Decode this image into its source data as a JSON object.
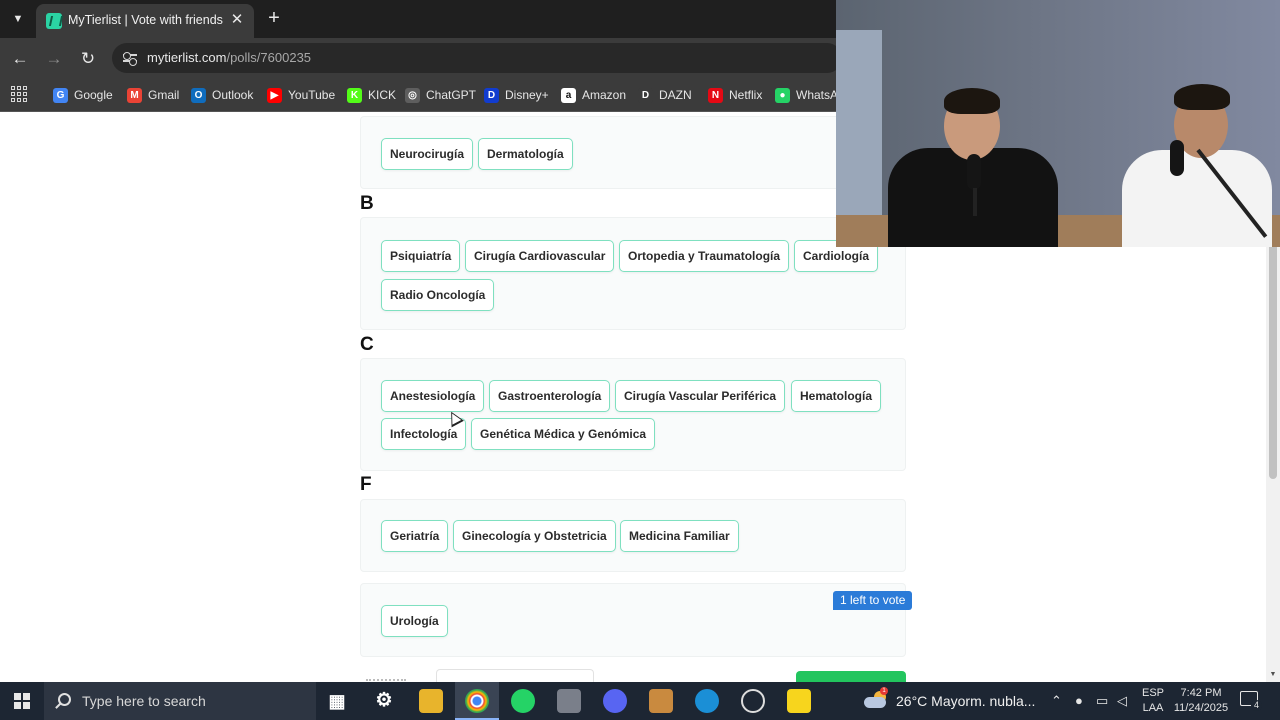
{
  "browser": {
    "tab_title": "MyTierlist | Vote with friends",
    "url_host": "mytierlist.com",
    "url_path": "/polls/7600235",
    "bookmarks": [
      {
        "label": "Google",
        "icon": "google-icon",
        "color": "#4285f4"
      },
      {
        "label": "Gmail",
        "icon": "gmail-icon",
        "color": "#ea4335"
      },
      {
        "label": "Outlook",
        "icon": "outlook-icon",
        "color": "#0f6cbd"
      },
      {
        "label": "YouTube",
        "icon": "youtube-icon",
        "color": "#ff0000"
      },
      {
        "label": "KICK",
        "icon": "kick-icon",
        "color": "#53fc18"
      },
      {
        "label": "ChatGPT",
        "icon": "chatgpt-icon",
        "color": "#5e5e5e"
      },
      {
        "label": "Disney+",
        "icon": "disney-icon",
        "color": "#113ccf"
      },
      {
        "label": "Amazon",
        "icon": "amazon-icon",
        "color": "#ffffff"
      },
      {
        "label": "DAZN",
        "icon": "dazn-icon",
        "color": "#3b3b3b"
      },
      {
        "label": "Netflix",
        "icon": "netflix-icon",
        "color": "#e50914"
      },
      {
        "label": "WhatsAp",
        "icon": "whatsapp-icon",
        "color": "#25d366"
      }
    ]
  },
  "tierlist": {
    "top_items": [
      "Neurocirugía",
      "Dermatología"
    ],
    "tiers": [
      {
        "label": "B",
        "items": [
          "Psiquiatría",
          "Cirugía Cardiovascular",
          "Ortopedia y Traumatología",
          "Cardiología",
          "Radio Oncología"
        ]
      },
      {
        "label": "C",
        "items": [
          "Anestesiología",
          "Gastroenterología",
          "Cirugía Vascular Periférica",
          "Hematología",
          "Infectología",
          "Genética Médica y Genómica"
        ]
      },
      {
        "label": "F",
        "items": [
          "Geriatría",
          "Ginecología y Obstetricia",
          "Medicina Familiar"
        ]
      }
    ],
    "unranked_items": [
      "Urología"
    ],
    "votes_left_badge": "1 left to vote"
  },
  "taskbar": {
    "search_placeholder": "Type here to search",
    "weather": "26°C  Mayorm. nubla...",
    "language_line1": "ESP",
    "language_line2": "LAA",
    "time": "7:42 PM",
    "date": "11/24/2025",
    "notification_count": "4"
  },
  "colors": {
    "chip_border": "#7fe0c0",
    "badge": "#2b7bd8",
    "brand": "#2bd3a4"
  }
}
